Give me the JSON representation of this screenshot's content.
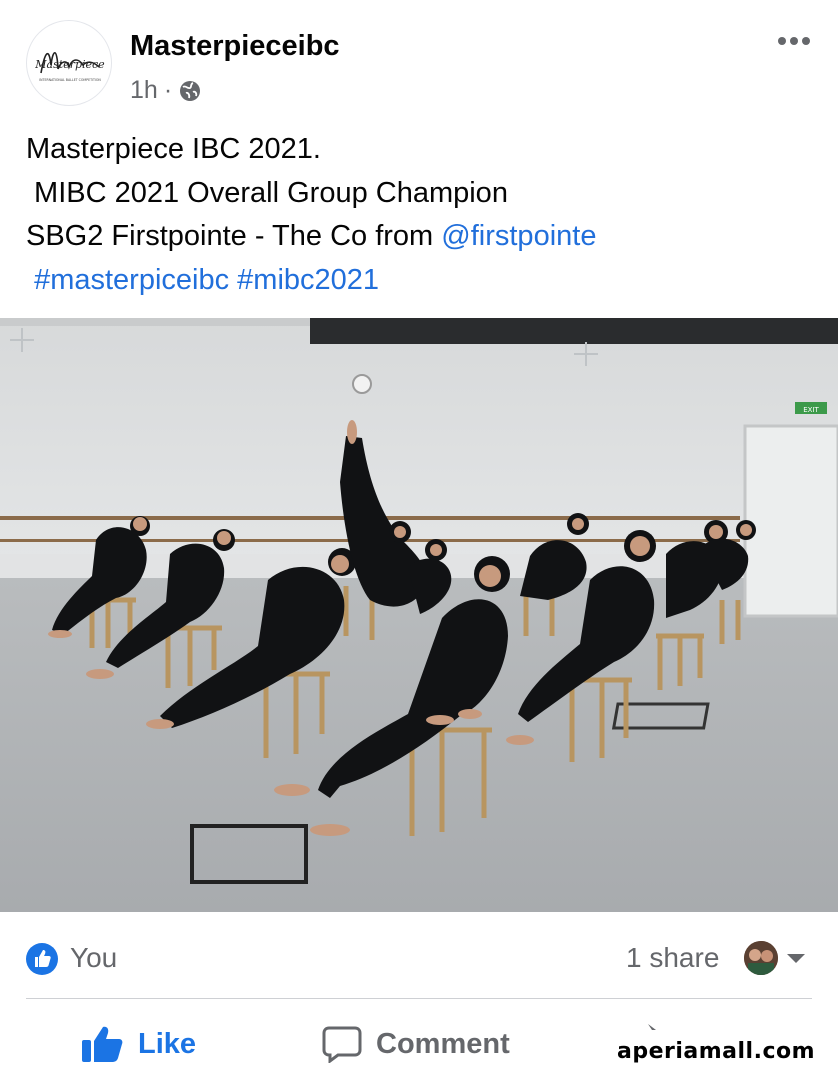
{
  "post": {
    "page_name": "Masterpieceibc",
    "timestamp": "1h",
    "separator": "·",
    "privacy_icon": "globe-icon",
    "avatar_logo_text": "Masterpiece",
    "avatar_logo_subtext": "INTERNATIONAL BALLET COMPETITION",
    "text_line_1": "Masterpiece IBC 2021.",
    "text_line_2": " MIBC 2021 Overall Group Champion",
    "text_line_3_prefix": "SBG2 Firstpointe - The Co from ",
    "mention": "@firstpointe",
    "hashtag_1": "#masterpiceibc",
    "hashtag_2": "#mibc2021"
  },
  "photo": {
    "exit_sign": "EXIT"
  },
  "reactions": {
    "reactor": "You",
    "shares": "1 share"
  },
  "actions": {
    "like": "Like",
    "comment": "Comment"
  },
  "watermark": "aperiamall.com",
  "colors": {
    "link": "#216fdb",
    "brand_blue": "#1b74e4",
    "muted": "#65676b"
  }
}
